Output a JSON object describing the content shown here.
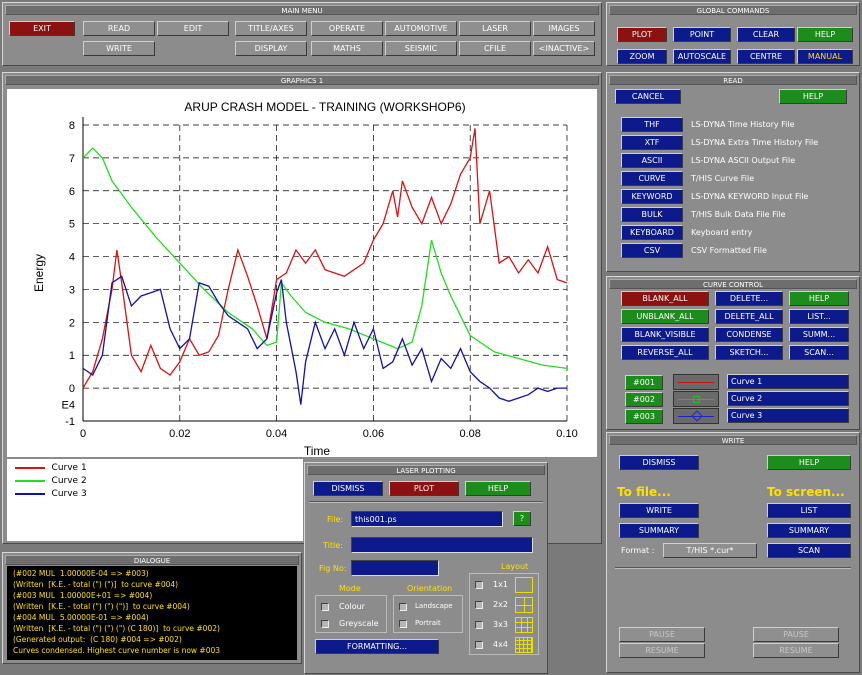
{
  "main_menu": {
    "title": "MAIN MENU",
    "exit": "EXIT",
    "row1": [
      "READ",
      "EDIT",
      "TITLE/AXES",
      "OPERATE",
      "AUTOMOTIVE",
      "LASER",
      "IMAGES"
    ],
    "row2": [
      "WRITE",
      "DISPLAY",
      "MATHS",
      "SEISMIC",
      "CFILE",
      "<INACTIVE>"
    ]
  },
  "global": {
    "title": "GLOBAL COMMANDS",
    "row1": [
      "PLOT",
      "POINT",
      "CLEAR",
      "HELP"
    ],
    "row2": [
      "ZOOM",
      "AUTOSCALE",
      "CENTRE",
      "MANUAL"
    ]
  },
  "graphics": {
    "title": "GRAPHICS 1"
  },
  "read": {
    "title": "READ",
    "cancel": "CANCEL",
    "help": "HELP",
    "items": [
      {
        "btn": "THF",
        "desc": "LS-DYNA Time History File"
      },
      {
        "btn": "XTF",
        "desc": "LS-DYNA Extra Time History File"
      },
      {
        "btn": "ASCII",
        "desc": "LS-DYNA ASCII Output File"
      },
      {
        "btn": "CURVE",
        "desc": "T/HIS Curve File"
      },
      {
        "btn": "KEYWORD",
        "desc": "LS-DYNA KEYWORD Input File"
      },
      {
        "btn": "BULK",
        "desc": "T/HIS Bulk Data File File"
      },
      {
        "btn": "KEYBOARD",
        "desc": "Keyboard entry"
      },
      {
        "btn": "CSV",
        "desc": "CSV Formatted File"
      }
    ]
  },
  "curve_control": {
    "title": "CURVE CONTROL",
    "rows": [
      [
        "BLANK_ALL",
        "DELETE...",
        "HELP"
      ],
      [
        "UNBLANK_ALL",
        "DELETE_ALL",
        "LIST..."
      ],
      [
        "BLANK_VISIBLE",
        "CONDENSE",
        "SUMM..."
      ],
      [
        "REVERSE_ALL",
        "SKETCH...",
        "SCAN..."
      ]
    ],
    "curves": [
      {
        "id": "#001",
        "name": "Curve 1",
        "color": "#cc1111"
      },
      {
        "id": "#002",
        "name": "Curve 2",
        "color": "#11cc11"
      },
      {
        "id": "#003",
        "name": "Curve 3",
        "color": "#1111aa"
      }
    ]
  },
  "write": {
    "title": "WRITE",
    "dismiss": "DISMISS",
    "help": "HELP",
    "to_file": "To file...",
    "to_screen": "To screen...",
    "file_write": "WRITE",
    "file_summary": "SUMMARY",
    "screen_list": "LIST",
    "screen_summary": "SUMMARY",
    "format_label": "Format :",
    "format_value": "T/HIS *.cur*",
    "scan": "SCAN",
    "pause": "PAUSE",
    "resume": "RESUME"
  },
  "laser": {
    "title": "LASER PLOTTING",
    "dismiss": "DISMISS",
    "plot": "PLOT",
    "help": "HELP",
    "file_label": "File:",
    "file_value": "this001.ps",
    "q": "?",
    "title_label": "Title:",
    "title_value": "",
    "figno_label": "Fig No:",
    "figno_value": "",
    "mode_label": "Mode",
    "mode_options": [
      "Colour",
      "Greyscale"
    ],
    "orient_label": "Orientation",
    "orient_options": [
      "Landscape",
      "Portrait"
    ],
    "layout_label": "Layout",
    "layout_options": [
      "1x1",
      "2x2",
      "3x3",
      "4x4"
    ],
    "formatting": "FORMATTING..."
  },
  "dialogue": {
    "title": "DIALOGUE",
    "lines": [
      "(#002 MUL  1.00000E-04 => #003)",
      "(Written  [K.E. - total (\") (\")]  to curve #004)",
      "(#003 MUL  1.00000E+01 => #004)",
      "(Written  [K.E. - total (\") (\") (\")]  to curve #004)",
      "(#004 MUL  5.00000E-01 => #004)",
      "(Written  [K.E. - total (\") (\") (\") (C 180)]  to curve #002)",
      "(Generated output:  (C 180) #004 => #002)",
      "Curves condensed. Highest curve number is now #003",
      "_"
    ]
  },
  "chart_data": {
    "type": "line",
    "title": "ARUP CRASH MODEL - TRAINING (WORKSHOP6)",
    "xlabel": "Time",
    "ylabel": "Energy",
    "yunit": "E4",
    "xlim": [
      0,
      0.1
    ],
    "ylim": [
      -1,
      8
    ],
    "xticks": [
      "0",
      "0.02",
      "0.04",
      "0.06",
      "0.08",
      "0.10"
    ],
    "yticks": [
      "-1",
      "0",
      "1",
      "2",
      "3",
      "4",
      "5",
      "6",
      "7",
      "8"
    ],
    "series": [
      {
        "name": "Curve 1",
        "color": "#dd1111",
        "points": [
          [
            0,
            0
          ],
          [
            0.002,
            0.5
          ],
          [
            0.004,
            1.5
          ],
          [
            0.006,
            3.0
          ],
          [
            0.007,
            4.2
          ],
          [
            0.008,
            3.2
          ],
          [
            0.01,
            1.0
          ],
          [
            0.012,
            0.5
          ],
          [
            0.014,
            1.3
          ],
          [
            0.016,
            0.6
          ],
          [
            0.018,
            0.4
          ],
          [
            0.02,
            0.8
          ],
          [
            0.022,
            1.5
          ],
          [
            0.024,
            1.0
          ],
          [
            0.026,
            1.1
          ],
          [
            0.028,
            1.6
          ],
          [
            0.03,
            3.0
          ],
          [
            0.032,
            4.2
          ],
          [
            0.034,
            3.4
          ],
          [
            0.036,
            2.5
          ],
          [
            0.038,
            1.5
          ],
          [
            0.04,
            3.3
          ],
          [
            0.042,
            3.5
          ],
          [
            0.044,
            4.2
          ],
          [
            0.046,
            3.8
          ],
          [
            0.048,
            4.2
          ],
          [
            0.05,
            3.6
          ],
          [
            0.052,
            3.5
          ],
          [
            0.054,
            3.4
          ],
          [
            0.056,
            3.6
          ],
          [
            0.058,
            3.8
          ],
          [
            0.06,
            4.5
          ],
          [
            0.062,
            5.0
          ],
          [
            0.064,
            6.0
          ],
          [
            0.065,
            5.2
          ],
          [
            0.066,
            6.3
          ],
          [
            0.068,
            5.5
          ],
          [
            0.07,
            5.0
          ],
          [
            0.072,
            5.8
          ],
          [
            0.074,
            5.0
          ],
          [
            0.076,
            5.6
          ],
          [
            0.078,
            6.5
          ],
          [
            0.08,
            7.0
          ],
          [
            0.081,
            7.9
          ],
          [
            0.082,
            5.0
          ],
          [
            0.084,
            6.0
          ],
          [
            0.086,
            3.8
          ],
          [
            0.088,
            4.0
          ],
          [
            0.09,
            3.5
          ],
          [
            0.092,
            3.9
          ],
          [
            0.094,
            3.5
          ],
          [
            0.096,
            4.3
          ],
          [
            0.098,
            3.3
          ],
          [
            0.1,
            3.2
          ]
        ]
      },
      {
        "name": "Curve 2",
        "color": "#22dd22",
        "points": [
          [
            0,
            7.0
          ],
          [
            0.002,
            7.3
          ],
          [
            0.004,
            7.0
          ],
          [
            0.006,
            6.3
          ],
          [
            0.01,
            5.5
          ],
          [
            0.015,
            4.6
          ],
          [
            0.02,
            3.8
          ],
          [
            0.025,
            3.0
          ],
          [
            0.03,
            2.3
          ],
          [
            0.035,
            1.8
          ],
          [
            0.038,
            1.3
          ],
          [
            0.04,
            1.4
          ],
          [
            0.041,
            3.2
          ],
          [
            0.043,
            2.8
          ],
          [
            0.046,
            2.3
          ],
          [
            0.05,
            2.0
          ],
          [
            0.055,
            1.8
          ],
          [
            0.06,
            1.5
          ],
          [
            0.065,
            1.2
          ],
          [
            0.068,
            1.4
          ],
          [
            0.07,
            2.5
          ],
          [
            0.072,
            4.5
          ],
          [
            0.074,
            3.5
          ],
          [
            0.076,
            2.8
          ],
          [
            0.078,
            2.2
          ],
          [
            0.08,
            1.6
          ],
          [
            0.085,
            1.1
          ],
          [
            0.09,
            0.9
          ],
          [
            0.095,
            0.7
          ],
          [
            0.1,
            0.6
          ]
        ]
      },
      {
        "name": "Curve 3",
        "color": "#1111aa",
        "points": [
          [
            0,
            0.6
          ],
          [
            0.002,
            0.4
          ],
          [
            0.004,
            1.0
          ],
          [
            0.006,
            3.2
          ],
          [
            0.008,
            3.4
          ],
          [
            0.01,
            2.5
          ],
          [
            0.012,
            2.8
          ],
          [
            0.014,
            2.9
          ],
          [
            0.016,
            3.0
          ],
          [
            0.018,
            1.8
          ],
          [
            0.02,
            1.2
          ],
          [
            0.022,
            1.5
          ],
          [
            0.024,
            3.2
          ],
          [
            0.026,
            3.1
          ],
          [
            0.028,
            2.6
          ],
          [
            0.03,
            2.2
          ],
          [
            0.032,
            2.0
          ],
          [
            0.034,
            1.8
          ],
          [
            0.036,
            1.2
          ],
          [
            0.038,
            1.5
          ],
          [
            0.04,
            2.9
          ],
          [
            0.041,
            3.3
          ],
          [
            0.042,
            2.0
          ],
          [
            0.044,
            0.5
          ],
          [
            0.045,
            -0.5
          ],
          [
            0.046,
            0.8
          ],
          [
            0.048,
            2.0
          ],
          [
            0.05,
            1.2
          ],
          [
            0.052,
            1.8
          ],
          [
            0.054,
            1.0
          ],
          [
            0.056,
            2.0
          ],
          [
            0.058,
            1.2
          ],
          [
            0.06,
            1.8
          ],
          [
            0.062,
            0.6
          ],
          [
            0.064,
            0.8
          ],
          [
            0.066,
            1.5
          ],
          [
            0.068,
            0.7
          ],
          [
            0.07,
            1.2
          ],
          [
            0.072,
            0.2
          ],
          [
            0.074,
            0.9
          ],
          [
            0.076,
            0.6
          ],
          [
            0.078,
            1.2
          ],
          [
            0.08,
            0.5
          ],
          [
            0.082,
            0.2
          ],
          [
            0.084,
            0.0
          ],
          [
            0.086,
            -0.3
          ],
          [
            0.088,
            -0.4
          ],
          [
            0.09,
            -0.3
          ],
          [
            0.092,
            -0.2
          ],
          [
            0.094,
            0.0
          ],
          [
            0.096,
            -0.1
          ],
          [
            0.098,
            0.0
          ],
          [
            0.1,
            0.0
          ]
        ]
      }
    ]
  }
}
